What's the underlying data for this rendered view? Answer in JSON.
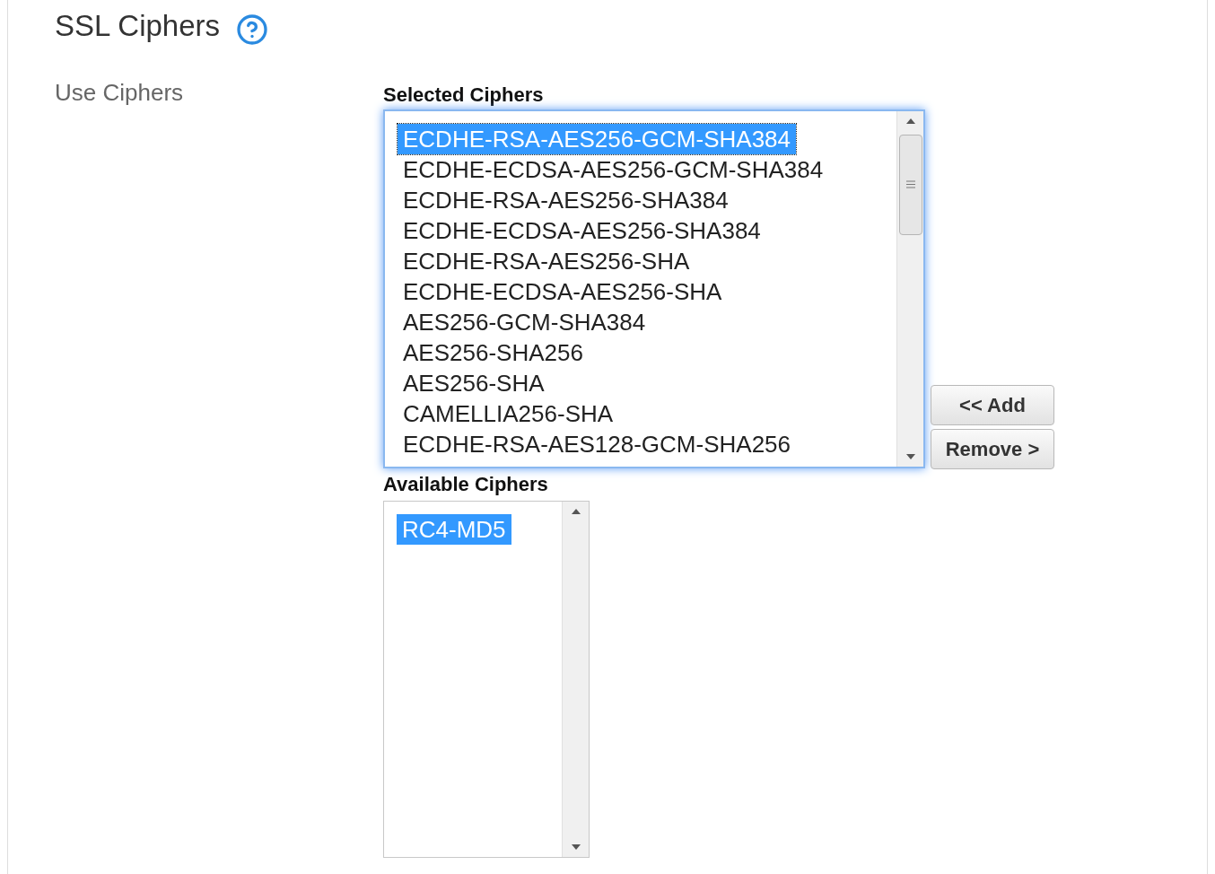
{
  "title": "SSL Ciphers",
  "field_label": "Use Ciphers",
  "selected_list": {
    "label": "Selected Ciphers",
    "focused": true,
    "items": [
      {
        "text": "ECDHE-RSA-AES256-GCM-SHA384",
        "selected": true
      },
      {
        "text": "ECDHE-ECDSA-AES256-GCM-SHA384",
        "selected": false
      },
      {
        "text": "ECDHE-RSA-AES256-SHA384",
        "selected": false
      },
      {
        "text": "ECDHE-ECDSA-AES256-SHA384",
        "selected": false
      },
      {
        "text": "ECDHE-RSA-AES256-SHA",
        "selected": false
      },
      {
        "text": "ECDHE-ECDSA-AES256-SHA",
        "selected": false
      },
      {
        "text": "AES256-GCM-SHA384",
        "selected": false
      },
      {
        "text": "AES256-SHA256",
        "selected": false
      },
      {
        "text": "AES256-SHA",
        "selected": false
      },
      {
        "text": "CAMELLIA256-SHA",
        "selected": false
      },
      {
        "text": "ECDHE-RSA-AES128-GCM-SHA256",
        "selected": false
      }
    ]
  },
  "buttons": [
    "<< Add",
    "Remove >"
  ],
  "available_list": {
    "label": "Available Ciphers",
    "focused": false,
    "items": [
      {
        "text": "RC4-MD5",
        "selected": true
      }
    ]
  }
}
